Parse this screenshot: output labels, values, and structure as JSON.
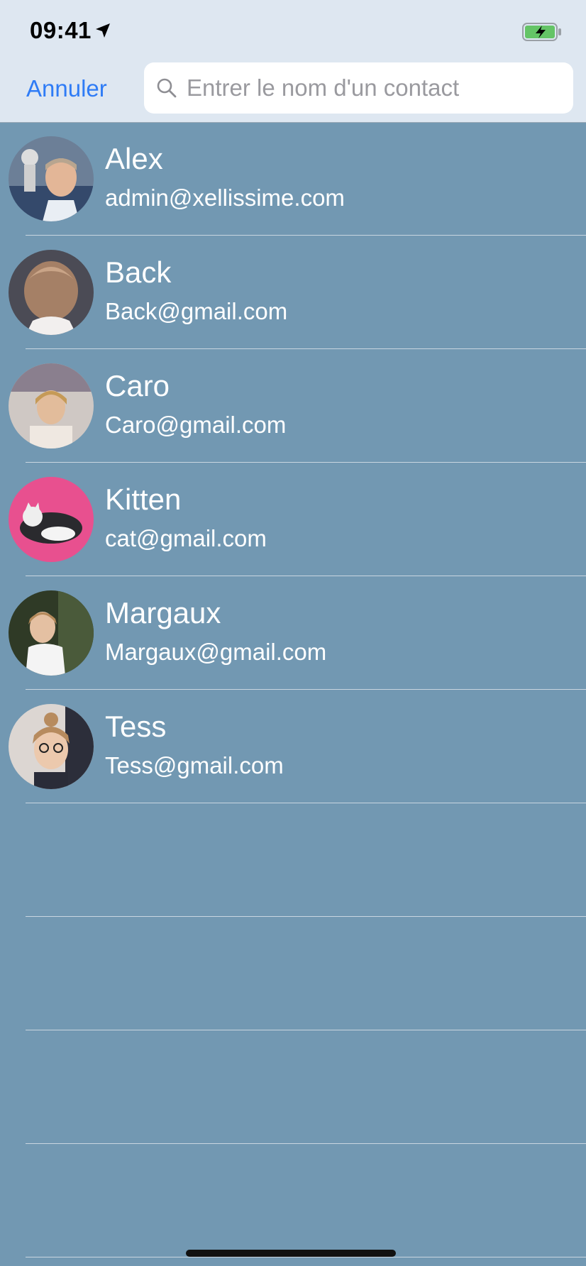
{
  "status_bar": {
    "time": "09:41",
    "location_icon": "location-arrow-icon",
    "battery_icon": "battery-charging-icon"
  },
  "nav": {
    "cancel_label": "Annuler",
    "search_placeholder": "Entrer le nom d'un contact",
    "search_value": ""
  },
  "contacts": [
    {
      "name": "Alex",
      "email": "admin@xellissime.com"
    },
    {
      "name": "Back",
      "email": "Back@gmail.com"
    },
    {
      "name": "Caro",
      "email": "Caro@gmail.com"
    },
    {
      "name": "Kitten",
      "email": "cat@gmail.com"
    },
    {
      "name": "Margaux",
      "email": "Margaux@gmail.com"
    },
    {
      "name": "Tess",
      "email": "Tess@gmail.com"
    }
  ],
  "colors": {
    "list_background": "#7298b2",
    "nav_background": "#dee7f1",
    "accent": "#2f7cf6"
  }
}
